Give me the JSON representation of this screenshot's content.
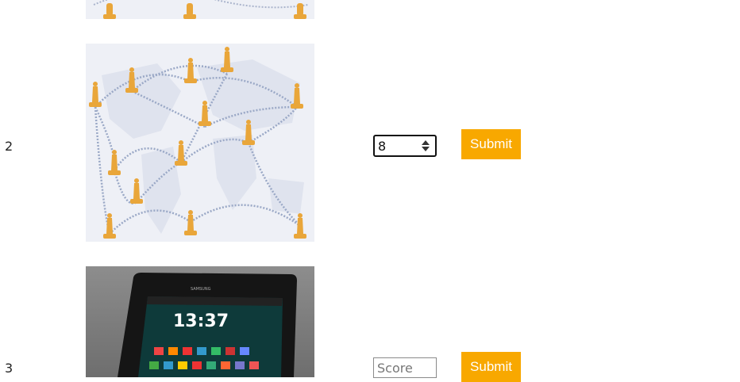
{
  "rows": [
    {
      "number": "",
      "input_value": "",
      "submit_label": ""
    },
    {
      "number": "2",
      "input_value": "8",
      "submit_label": "Submit"
    },
    {
      "number": "3",
      "input_placeholder": "Score",
      "submit_label": "Submit"
    }
  ],
  "tablet": {
    "brand": "SAMSUNG",
    "clock": "13:37"
  },
  "colors": {
    "button": "#f8a800",
    "map_background": "#eef0f6",
    "pin": "#e9a63a"
  }
}
